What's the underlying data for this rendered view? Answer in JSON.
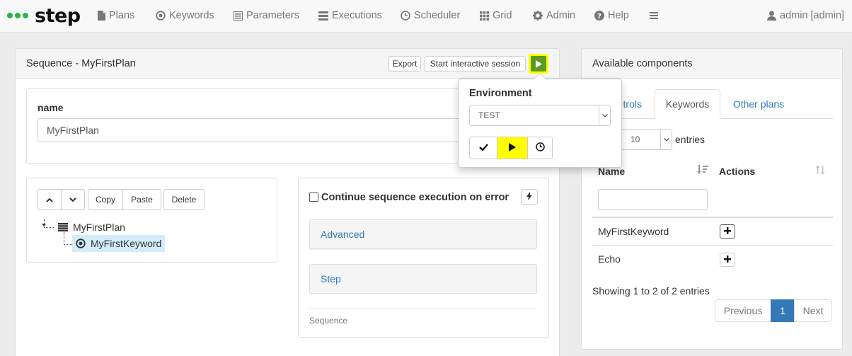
{
  "brand": {
    "name": "step"
  },
  "nav": {
    "plans": "Plans",
    "keywords": "Keywords",
    "parameters": "Parameters",
    "executions": "Executions",
    "scheduler": "Scheduler",
    "grid": "Grid",
    "admin": "Admin",
    "help": "Help",
    "user": "admin [admin]"
  },
  "plan_panel": {
    "title": "Sequence - MyFirstPlan",
    "export_label": "Export",
    "interactive_label": "Start interactive session"
  },
  "name_form": {
    "label": "name",
    "value": "MyFirstPlan"
  },
  "tree_toolbar": {
    "copy": "Copy",
    "paste": "Paste",
    "delete": "Delete"
  },
  "tree": {
    "root": "MyFirstPlan",
    "child": "MyFirstKeyword"
  },
  "properties": {
    "continue_label": "Continue sequence execution on error",
    "advanced": "Advanced",
    "step": "Step",
    "footer": "Sequence"
  },
  "popover": {
    "title": "Environment",
    "selected": "TEST"
  },
  "components": {
    "title": "Available components",
    "tabs": [
      "Controls",
      "Keywords",
      "Other plans"
    ],
    "tab_controls_visible": "trols",
    "page_size": "10",
    "entries_label": "entries",
    "col_name": "Name",
    "col_actions": "Actions",
    "rows": [
      {
        "name": "MyFirstKeyword"
      },
      {
        "name": "Echo"
      }
    ],
    "info": "Showing 1 to 2 of 2 entries",
    "prev": "Previous",
    "page": "1",
    "next": "Next"
  },
  "colors": {
    "brand_green": "#2bb24c",
    "highlight": "#ffff00",
    "link": "#337ab7",
    "page_active": "#337ab7"
  }
}
